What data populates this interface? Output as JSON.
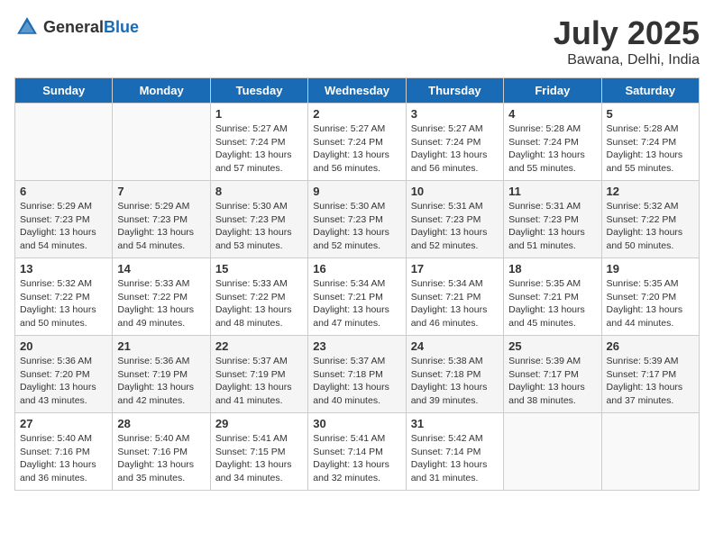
{
  "header": {
    "logo_general": "General",
    "logo_blue": "Blue",
    "month": "July 2025",
    "location": "Bawana, Delhi, India"
  },
  "weekdays": [
    "Sunday",
    "Monday",
    "Tuesday",
    "Wednesday",
    "Thursday",
    "Friday",
    "Saturday"
  ],
  "weeks": [
    [
      {
        "day": "",
        "info": ""
      },
      {
        "day": "",
        "info": ""
      },
      {
        "day": "1",
        "info": "Sunrise: 5:27 AM\nSunset: 7:24 PM\nDaylight: 13 hours and 57 minutes."
      },
      {
        "day": "2",
        "info": "Sunrise: 5:27 AM\nSunset: 7:24 PM\nDaylight: 13 hours and 56 minutes."
      },
      {
        "day": "3",
        "info": "Sunrise: 5:27 AM\nSunset: 7:24 PM\nDaylight: 13 hours and 56 minutes."
      },
      {
        "day": "4",
        "info": "Sunrise: 5:28 AM\nSunset: 7:24 PM\nDaylight: 13 hours and 55 minutes."
      },
      {
        "day": "5",
        "info": "Sunrise: 5:28 AM\nSunset: 7:24 PM\nDaylight: 13 hours and 55 minutes."
      }
    ],
    [
      {
        "day": "6",
        "info": "Sunrise: 5:29 AM\nSunset: 7:23 PM\nDaylight: 13 hours and 54 minutes."
      },
      {
        "day": "7",
        "info": "Sunrise: 5:29 AM\nSunset: 7:23 PM\nDaylight: 13 hours and 54 minutes."
      },
      {
        "day": "8",
        "info": "Sunrise: 5:30 AM\nSunset: 7:23 PM\nDaylight: 13 hours and 53 minutes."
      },
      {
        "day": "9",
        "info": "Sunrise: 5:30 AM\nSunset: 7:23 PM\nDaylight: 13 hours and 52 minutes."
      },
      {
        "day": "10",
        "info": "Sunrise: 5:31 AM\nSunset: 7:23 PM\nDaylight: 13 hours and 52 minutes."
      },
      {
        "day": "11",
        "info": "Sunrise: 5:31 AM\nSunset: 7:23 PM\nDaylight: 13 hours and 51 minutes."
      },
      {
        "day": "12",
        "info": "Sunrise: 5:32 AM\nSunset: 7:22 PM\nDaylight: 13 hours and 50 minutes."
      }
    ],
    [
      {
        "day": "13",
        "info": "Sunrise: 5:32 AM\nSunset: 7:22 PM\nDaylight: 13 hours and 50 minutes."
      },
      {
        "day": "14",
        "info": "Sunrise: 5:33 AM\nSunset: 7:22 PM\nDaylight: 13 hours and 49 minutes."
      },
      {
        "day": "15",
        "info": "Sunrise: 5:33 AM\nSunset: 7:22 PM\nDaylight: 13 hours and 48 minutes."
      },
      {
        "day": "16",
        "info": "Sunrise: 5:34 AM\nSunset: 7:21 PM\nDaylight: 13 hours and 47 minutes."
      },
      {
        "day": "17",
        "info": "Sunrise: 5:34 AM\nSunset: 7:21 PM\nDaylight: 13 hours and 46 minutes."
      },
      {
        "day": "18",
        "info": "Sunrise: 5:35 AM\nSunset: 7:21 PM\nDaylight: 13 hours and 45 minutes."
      },
      {
        "day": "19",
        "info": "Sunrise: 5:35 AM\nSunset: 7:20 PM\nDaylight: 13 hours and 44 minutes."
      }
    ],
    [
      {
        "day": "20",
        "info": "Sunrise: 5:36 AM\nSunset: 7:20 PM\nDaylight: 13 hours and 43 minutes."
      },
      {
        "day": "21",
        "info": "Sunrise: 5:36 AM\nSunset: 7:19 PM\nDaylight: 13 hours and 42 minutes."
      },
      {
        "day": "22",
        "info": "Sunrise: 5:37 AM\nSunset: 7:19 PM\nDaylight: 13 hours and 41 minutes."
      },
      {
        "day": "23",
        "info": "Sunrise: 5:37 AM\nSunset: 7:18 PM\nDaylight: 13 hours and 40 minutes."
      },
      {
        "day": "24",
        "info": "Sunrise: 5:38 AM\nSunset: 7:18 PM\nDaylight: 13 hours and 39 minutes."
      },
      {
        "day": "25",
        "info": "Sunrise: 5:39 AM\nSunset: 7:17 PM\nDaylight: 13 hours and 38 minutes."
      },
      {
        "day": "26",
        "info": "Sunrise: 5:39 AM\nSunset: 7:17 PM\nDaylight: 13 hours and 37 minutes."
      }
    ],
    [
      {
        "day": "27",
        "info": "Sunrise: 5:40 AM\nSunset: 7:16 PM\nDaylight: 13 hours and 36 minutes."
      },
      {
        "day": "28",
        "info": "Sunrise: 5:40 AM\nSunset: 7:16 PM\nDaylight: 13 hours and 35 minutes."
      },
      {
        "day": "29",
        "info": "Sunrise: 5:41 AM\nSunset: 7:15 PM\nDaylight: 13 hours and 34 minutes."
      },
      {
        "day": "30",
        "info": "Sunrise: 5:41 AM\nSunset: 7:14 PM\nDaylight: 13 hours and 32 minutes."
      },
      {
        "day": "31",
        "info": "Sunrise: 5:42 AM\nSunset: 7:14 PM\nDaylight: 13 hours and 31 minutes."
      },
      {
        "day": "",
        "info": ""
      },
      {
        "day": "",
        "info": ""
      }
    ]
  ]
}
